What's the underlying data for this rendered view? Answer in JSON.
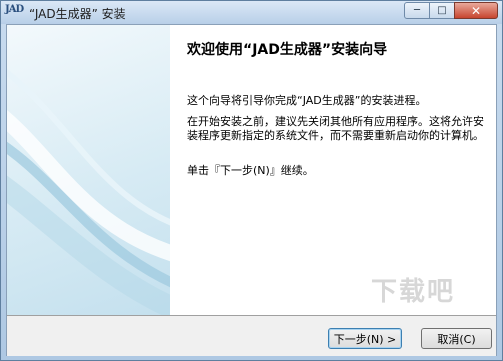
{
  "window": {
    "title": "“JAD生成器” 安装",
    "icon_text": "JAD",
    "controls": {
      "minimize": "─",
      "maximize": "□",
      "close": "✕"
    }
  },
  "content": {
    "heading": "欢迎使用“JAD生成器”安装向导",
    "paragraph1": "这个向导将引导你完成“JAD生成器”的安装进程。",
    "paragraph2": "在开始安装之前，建议先关闭其他所有应用程序。这将允许安装程序更新指定的系统文件，而不需要重新启动你的计算机。",
    "paragraph3": "单击『下一步(N)』继续。"
  },
  "buttons": {
    "next": "下一步(N) >",
    "cancel": "取消(C)"
  },
  "watermark": "下载吧",
  "colors": {
    "accent": "#3c7fb1",
    "banner": "#c4e0ee",
    "titlebar": "#b8cfe8"
  }
}
